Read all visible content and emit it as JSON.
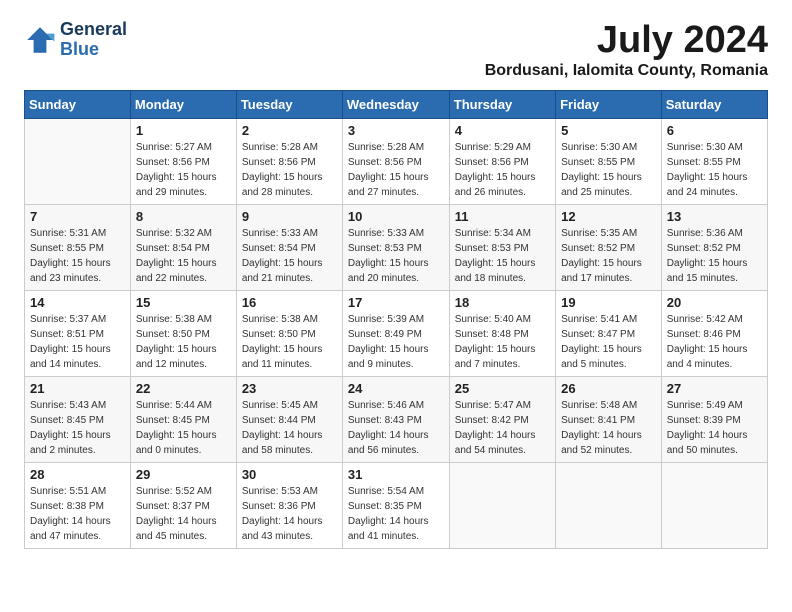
{
  "header": {
    "logo_line1": "General",
    "logo_line2": "Blue",
    "month_year": "July 2024",
    "location": "Bordusani, Ialomita County, Romania"
  },
  "days_of_week": [
    "Sunday",
    "Monday",
    "Tuesday",
    "Wednesday",
    "Thursday",
    "Friday",
    "Saturday"
  ],
  "weeks": [
    [
      {
        "day": "",
        "info": ""
      },
      {
        "day": "1",
        "info": "Sunrise: 5:27 AM\nSunset: 8:56 PM\nDaylight: 15 hours\nand 29 minutes."
      },
      {
        "day": "2",
        "info": "Sunrise: 5:28 AM\nSunset: 8:56 PM\nDaylight: 15 hours\nand 28 minutes."
      },
      {
        "day": "3",
        "info": "Sunrise: 5:28 AM\nSunset: 8:56 PM\nDaylight: 15 hours\nand 27 minutes."
      },
      {
        "day": "4",
        "info": "Sunrise: 5:29 AM\nSunset: 8:56 PM\nDaylight: 15 hours\nand 26 minutes."
      },
      {
        "day": "5",
        "info": "Sunrise: 5:30 AM\nSunset: 8:55 PM\nDaylight: 15 hours\nand 25 minutes."
      },
      {
        "day": "6",
        "info": "Sunrise: 5:30 AM\nSunset: 8:55 PM\nDaylight: 15 hours\nand 24 minutes."
      }
    ],
    [
      {
        "day": "7",
        "info": "Sunrise: 5:31 AM\nSunset: 8:55 PM\nDaylight: 15 hours\nand 23 minutes."
      },
      {
        "day": "8",
        "info": "Sunrise: 5:32 AM\nSunset: 8:54 PM\nDaylight: 15 hours\nand 22 minutes."
      },
      {
        "day": "9",
        "info": "Sunrise: 5:33 AM\nSunset: 8:54 PM\nDaylight: 15 hours\nand 21 minutes."
      },
      {
        "day": "10",
        "info": "Sunrise: 5:33 AM\nSunset: 8:53 PM\nDaylight: 15 hours\nand 20 minutes."
      },
      {
        "day": "11",
        "info": "Sunrise: 5:34 AM\nSunset: 8:53 PM\nDaylight: 15 hours\nand 18 minutes."
      },
      {
        "day": "12",
        "info": "Sunrise: 5:35 AM\nSunset: 8:52 PM\nDaylight: 15 hours\nand 17 minutes."
      },
      {
        "day": "13",
        "info": "Sunrise: 5:36 AM\nSunset: 8:52 PM\nDaylight: 15 hours\nand 15 minutes."
      }
    ],
    [
      {
        "day": "14",
        "info": "Sunrise: 5:37 AM\nSunset: 8:51 PM\nDaylight: 15 hours\nand 14 minutes."
      },
      {
        "day": "15",
        "info": "Sunrise: 5:38 AM\nSunset: 8:50 PM\nDaylight: 15 hours\nand 12 minutes."
      },
      {
        "day": "16",
        "info": "Sunrise: 5:38 AM\nSunset: 8:50 PM\nDaylight: 15 hours\nand 11 minutes."
      },
      {
        "day": "17",
        "info": "Sunrise: 5:39 AM\nSunset: 8:49 PM\nDaylight: 15 hours\nand 9 minutes."
      },
      {
        "day": "18",
        "info": "Sunrise: 5:40 AM\nSunset: 8:48 PM\nDaylight: 15 hours\nand 7 minutes."
      },
      {
        "day": "19",
        "info": "Sunrise: 5:41 AM\nSunset: 8:47 PM\nDaylight: 15 hours\nand 5 minutes."
      },
      {
        "day": "20",
        "info": "Sunrise: 5:42 AM\nSunset: 8:46 PM\nDaylight: 15 hours\nand 4 minutes."
      }
    ],
    [
      {
        "day": "21",
        "info": "Sunrise: 5:43 AM\nSunset: 8:45 PM\nDaylight: 15 hours\nand 2 minutes."
      },
      {
        "day": "22",
        "info": "Sunrise: 5:44 AM\nSunset: 8:45 PM\nDaylight: 15 hours\nand 0 minutes."
      },
      {
        "day": "23",
        "info": "Sunrise: 5:45 AM\nSunset: 8:44 PM\nDaylight: 14 hours\nand 58 minutes."
      },
      {
        "day": "24",
        "info": "Sunrise: 5:46 AM\nSunset: 8:43 PM\nDaylight: 14 hours\nand 56 minutes."
      },
      {
        "day": "25",
        "info": "Sunrise: 5:47 AM\nSunset: 8:42 PM\nDaylight: 14 hours\nand 54 minutes."
      },
      {
        "day": "26",
        "info": "Sunrise: 5:48 AM\nSunset: 8:41 PM\nDaylight: 14 hours\nand 52 minutes."
      },
      {
        "day": "27",
        "info": "Sunrise: 5:49 AM\nSunset: 8:39 PM\nDaylight: 14 hours\nand 50 minutes."
      }
    ],
    [
      {
        "day": "28",
        "info": "Sunrise: 5:51 AM\nSunset: 8:38 PM\nDaylight: 14 hours\nand 47 minutes."
      },
      {
        "day": "29",
        "info": "Sunrise: 5:52 AM\nSunset: 8:37 PM\nDaylight: 14 hours\nand 45 minutes."
      },
      {
        "day": "30",
        "info": "Sunrise: 5:53 AM\nSunset: 8:36 PM\nDaylight: 14 hours\nand 43 minutes."
      },
      {
        "day": "31",
        "info": "Sunrise: 5:54 AM\nSunset: 8:35 PM\nDaylight: 14 hours\nand 41 minutes."
      },
      {
        "day": "",
        "info": ""
      },
      {
        "day": "",
        "info": ""
      },
      {
        "day": "",
        "info": ""
      }
    ]
  ]
}
